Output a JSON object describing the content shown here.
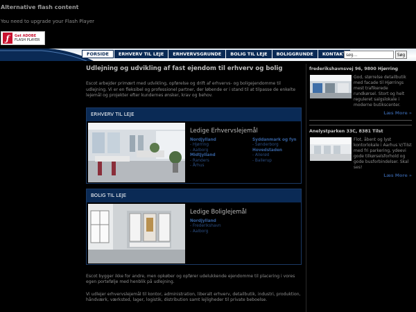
{
  "flash": {
    "title": "Alternative flash content",
    "message": "You need to upgrade your Flash Player",
    "badge_line1": "Get ADOBE",
    "badge_line2": "FLASH PLAYER"
  },
  "nav": {
    "items": [
      "FORSIDE",
      "ERHVERV TIL LEJE",
      "ERHVERVSGRUNDE",
      "BOLIG TIL LEJE",
      "BOLIGGRUNDE",
      "KONTAKT"
    ],
    "search_value": "søg...",
    "search_button": "Søg"
  },
  "main": {
    "heading": "Udlejning og udvikling af fast ejendom til erhverv og bolig",
    "intro": "Escot arbejder primært med udvikling, opførelse og drift af erhvervs- og boligejendomme til udlejning. Vi er en fleksibel og professionel partner, der løbende er i stand til at tilpasse de enkelte lejemål og projekter efter kundernes ønsker, krav og behov.",
    "erhverv": {
      "header": "ERHVERV TIL LEJE",
      "title": "Ledige Erhvervslejemål",
      "col1": [
        {
          "label": "Nordjylland",
          "bold": true
        },
        {
          "label": "- Hjørring",
          "bold": false
        },
        {
          "label": "- Aalborg",
          "bold": false
        },
        {
          "label": "Midtjylland",
          "bold": true
        },
        {
          "label": "- Randers",
          "bold": false
        },
        {
          "label": "- Århus",
          "bold": false
        }
      ],
      "col2": [
        {
          "label": "Syddanmark og fyn",
          "bold": true
        },
        {
          "label": "- Sønderborg",
          "bold": false
        },
        {
          "label": "Hovedstaden",
          "bold": true
        },
        {
          "label": "- Allerød",
          "bold": false
        },
        {
          "label": "- Ballerup",
          "bold": false
        }
      ]
    },
    "bolig": {
      "header": "BOLIG TIL LEJE",
      "title": "Ledige Boliglejemål",
      "col1": [
        {
          "label": "Nordjylland",
          "bold": true
        },
        {
          "label": "- Frederikshavn",
          "bold": false
        },
        {
          "label": "- Aalborg",
          "bold": false
        }
      ]
    },
    "footer_p1": "Escot bygger ikke for andre, men opkøber og opfører udelukkende ejendomme til placering i vores egen portefølje med henblik på udlejning.",
    "footer_p2": "Vi udlejer erhvervslejemål til kontor, administration, liberalt erhverv, detailbutik, industri, produktion, håndværk, værksted, lager, logistik, distribution samt lejligheder til private beboelse."
  },
  "sidebar": {
    "items": [
      {
        "title": "frederikshavnsvej 96, 9800 Hjørring",
        "text": "God, størrelse detailbutik med facade til Hjørrings mest trafikerede rundkørsel. Stort og helt reguleret salgslokale i moderne butikscenter.",
        "more": "Læs More »"
      },
      {
        "title": "Anelystparken 33C, 8381 Tilst",
        "text": "Flot, åbent og lyst kontorlokale i Aarhus V/Tilst med fri parkering, ydeevi gode tilkørselsforhold og gode busforbindelser. Skal ses!",
        "more": "Læs More »"
      }
    ]
  },
  "colors": {
    "nav_bg": "#0a2a55",
    "card_border": "#1b3a66",
    "link": "#2c4f85"
  }
}
